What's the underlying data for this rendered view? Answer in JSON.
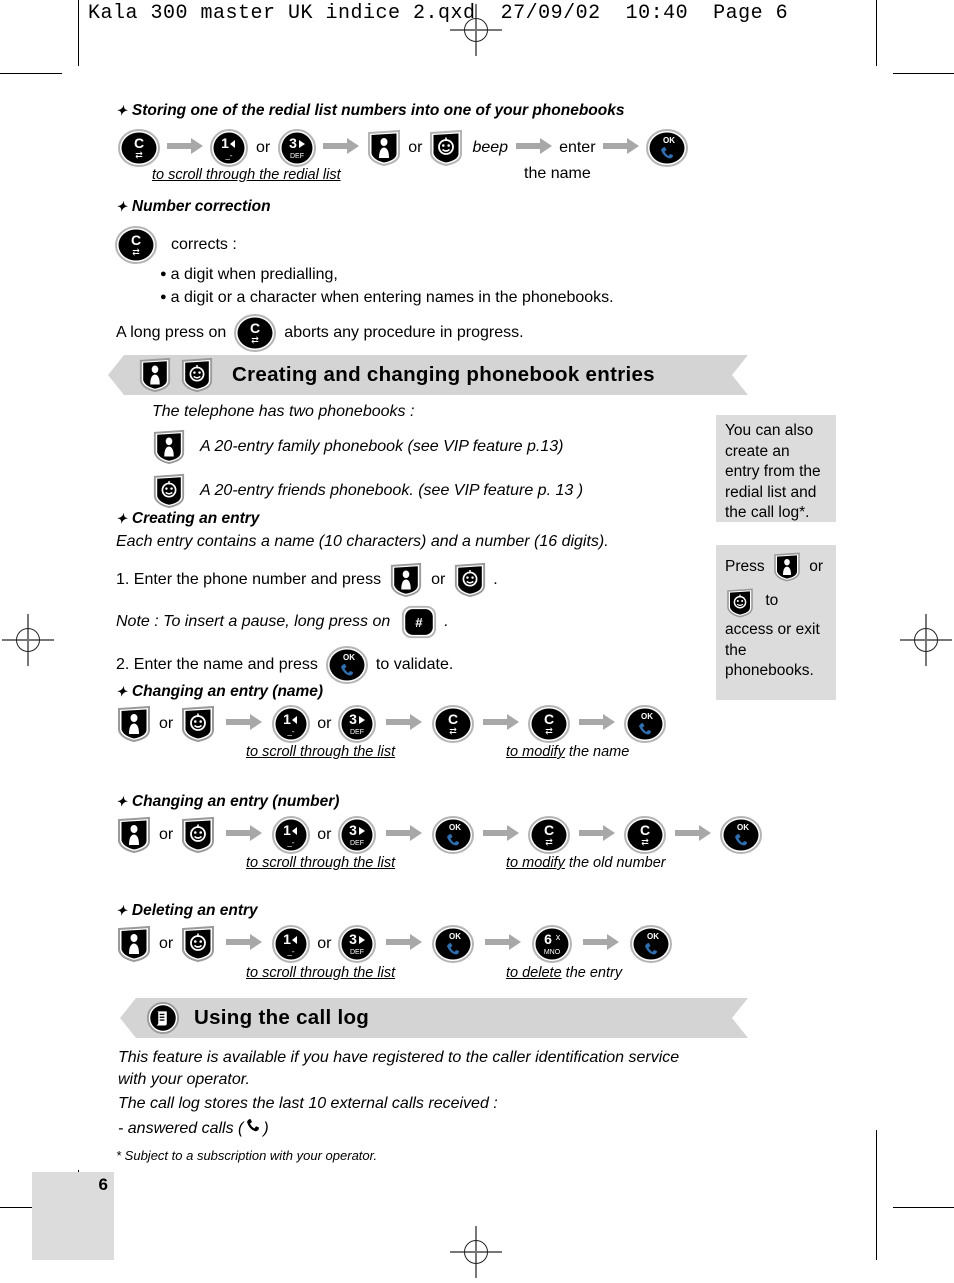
{
  "printer_header": {
    "text": "Kala 300 master UK indice 2.qxd  27/09/02  10:40  Page 6"
  },
  "page_number": "6",
  "sections": {
    "storing": {
      "heading": "Storing one of the redial list numbers into one of your phonebooks",
      "or_1": "or",
      "or_2": "or",
      "beep": "beep",
      "enter": "enter",
      "caption_left": "to scroll through the redial list",
      "caption_right": "the name"
    },
    "number_correction": {
      "heading": "Number correction",
      "corrects": "corrects :",
      "bullets": [
        "a digit when predialling,",
        "a digit or a character when entering names in the phonebooks."
      ],
      "long_press_before": "A long press on",
      "long_press_after": "aborts any procedure in progress."
    },
    "phonebook_banner": {
      "title": "Creating and changing phonebook entries"
    },
    "phonebooks_intro": {
      "lead": "The telephone has two phonebooks :",
      "family": "A 20-entry family phonebook (see VIP feature p.13)",
      "friends": "A 20-entry friends phonebook. (see VIP feature p. 13 )"
    },
    "creating_entry": {
      "heading": "Creating an entry",
      "subtitle": "Each entry contains a name (10 characters) and a number (16 digits).",
      "step1_before": "1. Enter the phone number and press",
      "step1_or": "or",
      "step1_after": ".",
      "note_before": "Note : To insert a pause, long press on",
      "note_after": ".",
      "step2_before": "2. Enter the name and press",
      "step2_after": "to validate."
    },
    "changing_name": {
      "heading": "Changing an entry (name)",
      "or_1": "or",
      "or_2": "or",
      "caption_left": "to scroll through the list",
      "caption_right_u": "to modify",
      "caption_right_rest": " the name"
    },
    "changing_number": {
      "heading": "Changing an entry (number)",
      "or_1": "or",
      "or_2": "or",
      "caption_left": "to scroll through the list",
      "caption_right_u": "to modify",
      "caption_right_rest": " the old number"
    },
    "deleting": {
      "heading": "Deleting an entry",
      "or_1": "or",
      "or_2": "or",
      "caption_left": "to scroll through the list",
      "caption_right_u": "to delete",
      "caption_right_rest": " the entry"
    },
    "call_log_banner": {
      "title": "Using the call log"
    },
    "call_log_body": {
      "line1": "This feature is available if you have registered to the caller identification service",
      "line2": "with your operator.",
      "line3": "The call log stores the last 10 external calls received :",
      "line4_before": "- answered calls (",
      "line4_after": ")"
    },
    "footnote": "* Subject to a subscription with your operator."
  },
  "sidebars": {
    "box1": "You can also create an entry from the redial list and the call log*.",
    "box2": {
      "press": "Press",
      "or": "or",
      "to": "to",
      "tail": "access or exit the phonebooks."
    }
  },
  "keys": {
    "c_key": "C",
    "key1_digit": "1",
    "key1_sub": "␣-",
    "key3_digit": "3",
    "key3_sub": "DEF",
    "key6_digit": "6",
    "key6_sub": "MNO",
    "key6_x": "x",
    "ok_label": "OK",
    "hash": "#"
  },
  "colors": {
    "key_black": "#000000",
    "key_ring": "#9a9a9a",
    "handset_blue": "#2f6fb0",
    "banner_gray": "#d4d4d4",
    "sidebar_gray": "#dcdcdc",
    "arrow_gray": "#a8a8a8"
  }
}
